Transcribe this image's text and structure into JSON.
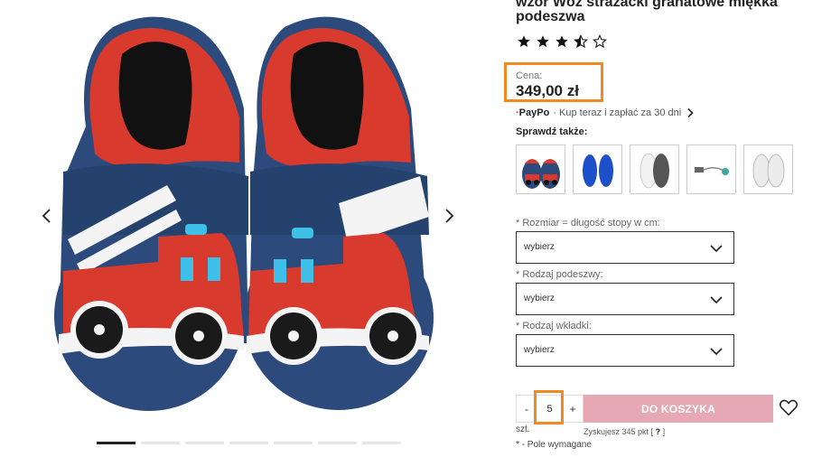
{
  "product": {
    "title": "wzór Wóz strażacki granatowe miękka podeszwa",
    "rating": 3.5,
    "rating_max": 5
  },
  "price": {
    "label": "Cena:",
    "value": "349,00 zł"
  },
  "paypo": {
    "logo": "PayPo",
    "text": "· Kup teraz i zapłać za 30 dni"
  },
  "see_also": {
    "label": "Sprawdź także:"
  },
  "options": {
    "size": {
      "label": "* Rozmiar = długość stopy w cm:",
      "value": "wybierz"
    },
    "sole": {
      "label": "* Rodzaj podeszwy:",
      "value": "wybierz"
    },
    "insole": {
      "label": "* Rodzaj wkładki:",
      "value": "wybierz"
    }
  },
  "cart": {
    "minus": "-",
    "plus": "+",
    "quantity": "5",
    "unit": "szt.",
    "button": "DO KOSZYKA",
    "points": "Zyskujesz 345 pkt [",
    "points_q": "?",
    "points_end": "]",
    "required": "* - Pole wymagane"
  },
  "gallery": {
    "slides": 7,
    "active_slide": 0
  },
  "colors": {
    "accent_highlight": "#f28a22",
    "cart_button": "#e6a9b4",
    "shoe_navy": "#2c4a7c",
    "shoe_red": "#d93a2e"
  },
  "icons": {
    "prev": "chevron-left-icon",
    "next": "chevron-right-icon",
    "wishlist": "heart-icon",
    "dropdown": "chevron-down-icon"
  }
}
